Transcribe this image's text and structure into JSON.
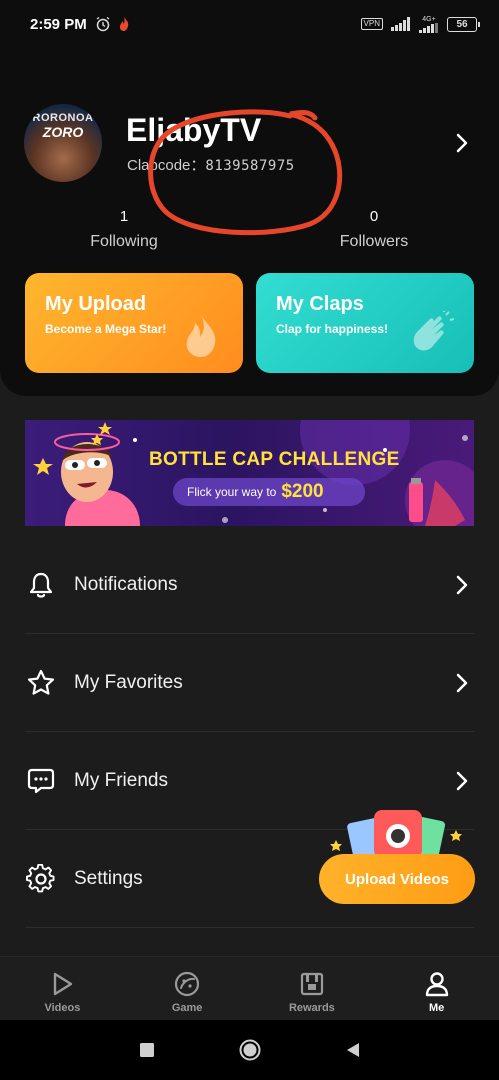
{
  "status_bar": {
    "time": "2:59 PM",
    "vpn": "VPN",
    "network": "4G+",
    "battery": "56"
  },
  "profile": {
    "avatar_text_top": "RORONOA",
    "avatar_text_bottom": "ZORO",
    "name": "EljabyTV",
    "clap_code_label": "Clapcode：",
    "clap_code_value": "8139587975",
    "following_count": "1",
    "following_label": "Following",
    "followers_count": "0",
    "followers_label": "Followers"
  },
  "promo": {
    "upload": {
      "title": "My Upload",
      "subtitle": "Become a Mega Star!"
    },
    "claps": {
      "title": "My Claps",
      "subtitle": "Clap for happiness!"
    }
  },
  "banner": {
    "title": "BOTTLE CAP CHALLENGE",
    "subtitle": "Flick your way to",
    "amount": "$200"
  },
  "menu": {
    "items": [
      {
        "label": "Notifications",
        "icon": "bell-icon"
      },
      {
        "label": "My Favorites",
        "icon": "star-icon"
      },
      {
        "label": "My Friends",
        "icon": "chat-icon"
      },
      {
        "label": "Settings",
        "icon": "gear-icon"
      }
    ]
  },
  "upload_button": {
    "label": "Upload Videos"
  },
  "bottom_nav": {
    "items": [
      {
        "label": "Videos",
        "icon": "play-icon"
      },
      {
        "label": "Game",
        "icon": "game-icon"
      },
      {
        "label": "Rewards",
        "icon": "rewards-icon"
      },
      {
        "label": "Me",
        "icon": "person-icon",
        "active": true
      }
    ]
  },
  "colors": {
    "background": "#1c1c1c",
    "card_background": "#0d0d0d",
    "upload_orange": "#ffa324",
    "claps_teal": "#22cdc4",
    "banner_yellow": "#ffe23a",
    "annotation_red": "#e8462a"
  }
}
